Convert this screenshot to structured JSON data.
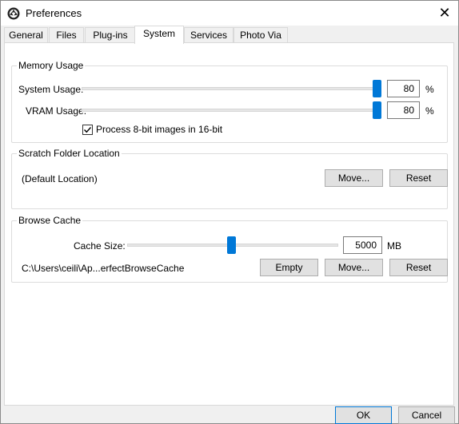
{
  "window": {
    "title": "Preferences",
    "close_glyph": "✕"
  },
  "tabs": [
    {
      "label": "General",
      "active": false
    },
    {
      "label": "Files",
      "active": false
    },
    {
      "label": "Plug-ins",
      "active": false
    },
    {
      "label": "System",
      "active": true
    },
    {
      "label": "Services",
      "active": false
    },
    {
      "label": "Photo Via",
      "active": false
    }
  ],
  "memory_usage": {
    "title": "Memory Usage",
    "system_usage": {
      "label": "System Usage:",
      "value": "80",
      "unit": "%",
      "level": 0.8
    },
    "vram_usage": {
      "label": "VRAM Usage:",
      "value": "80",
      "unit": "%",
      "level": 0.8
    },
    "process_8bit": {
      "label": "Process 8-bit images in 16-bit",
      "checked": true
    }
  },
  "scratch_folder": {
    "title": "Scratch Folder Location",
    "path": "(Default Location)",
    "move_label": "Move...",
    "reset_label": "Reset"
  },
  "browse_cache": {
    "title": "Browse Cache",
    "cache_size": {
      "label": "Cache Size:",
      "value": "5000",
      "unit": "MB",
      "level": 0.5
    },
    "path": "C:\\Users\\ceili\\Ap...erfectBrowseCache",
    "empty_label": "Empty",
    "move_label": "Move...",
    "reset_label": "Reset"
  },
  "footer": {
    "ok_label": "OK",
    "cancel_label": "Cancel"
  },
  "colors": {
    "accent": "#0078d7"
  }
}
